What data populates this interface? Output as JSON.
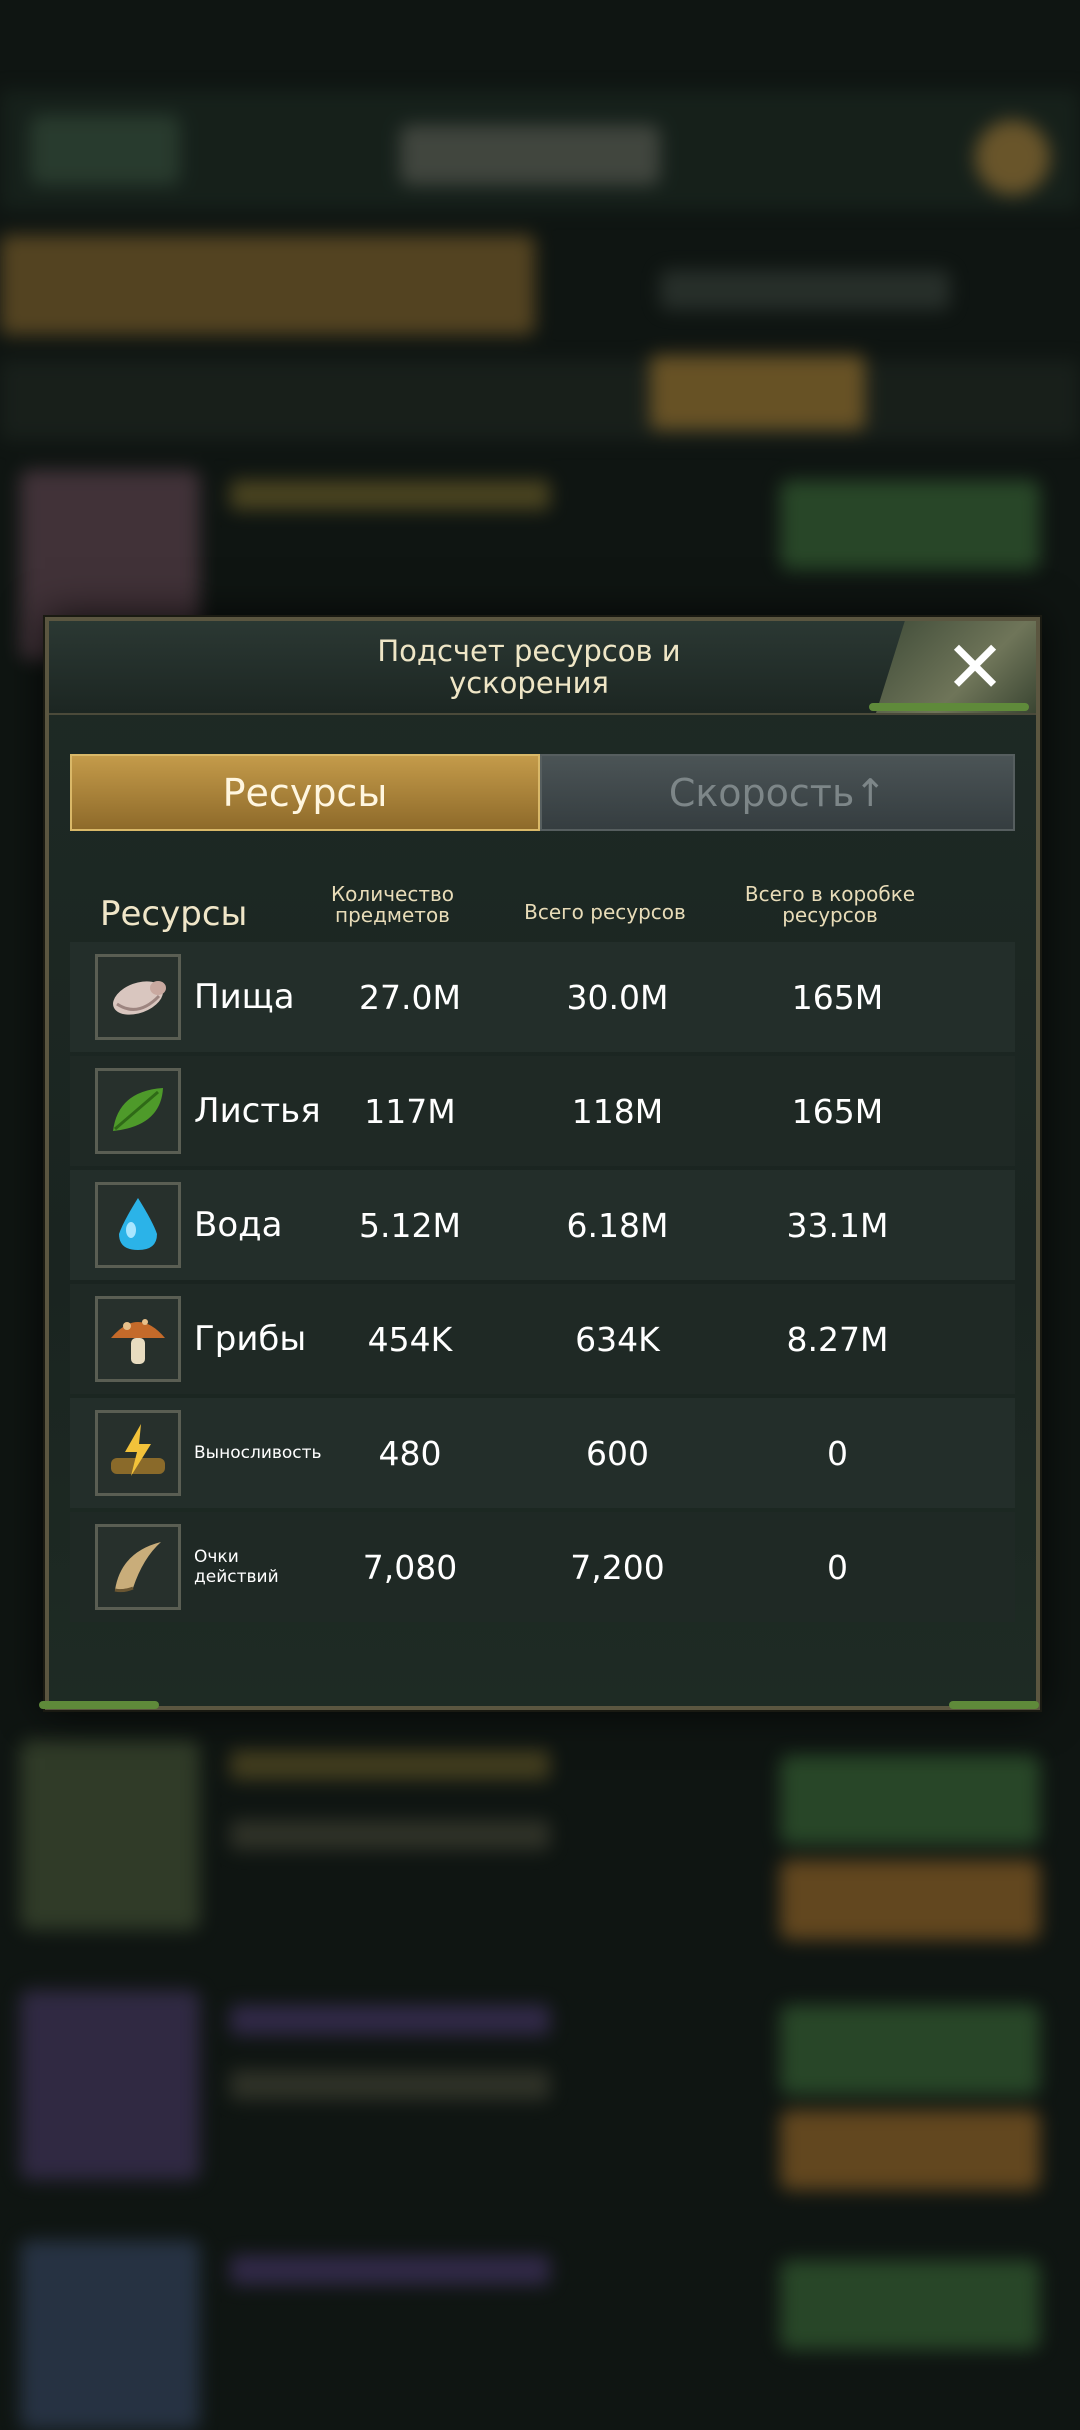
{
  "modal": {
    "title": "Подсчет ресурсов и\nускорения",
    "close_icon": "close-x-icon"
  },
  "tabs": [
    {
      "label": "Ресурсы",
      "active": true
    },
    {
      "label": "Скорость↑",
      "active": false
    }
  ],
  "table": {
    "headers": {
      "resources": "Ресурсы",
      "item_count": "Количество\nпредметов",
      "total": "Всего ресурсов",
      "in_box": "Всего в коробке\nресурсов"
    },
    "rows": [
      {
        "icon": "grub-icon",
        "name": "Пища",
        "item_count": "27.0M",
        "total": "30.0M",
        "in_box": "165M"
      },
      {
        "icon": "leaf-icon",
        "name": "Листья",
        "item_count": "117M",
        "total": "118M",
        "in_box": "165M"
      },
      {
        "icon": "water-drop-icon",
        "name": "Вода",
        "item_count": "5.12M",
        "total": "6.18M",
        "in_box": "33.1M"
      },
      {
        "icon": "mushroom-icon",
        "name": "Грибы",
        "item_count": "454K",
        "total": "634K",
        "in_box": "8.27M"
      },
      {
        "icon": "stamina-icon",
        "name": "Выносливость",
        "item_count": "480",
        "total": "600",
        "in_box": "0"
      },
      {
        "icon": "horn-icon",
        "name": "Очки\nдействий",
        "item_count": "7,080",
        "total": "7,200",
        "in_box": "0"
      }
    ]
  },
  "colors": {
    "accent_gold": "#c49b4a",
    "text_header": "#e8dcb8",
    "panel_bg": "#1e2a25"
  }
}
